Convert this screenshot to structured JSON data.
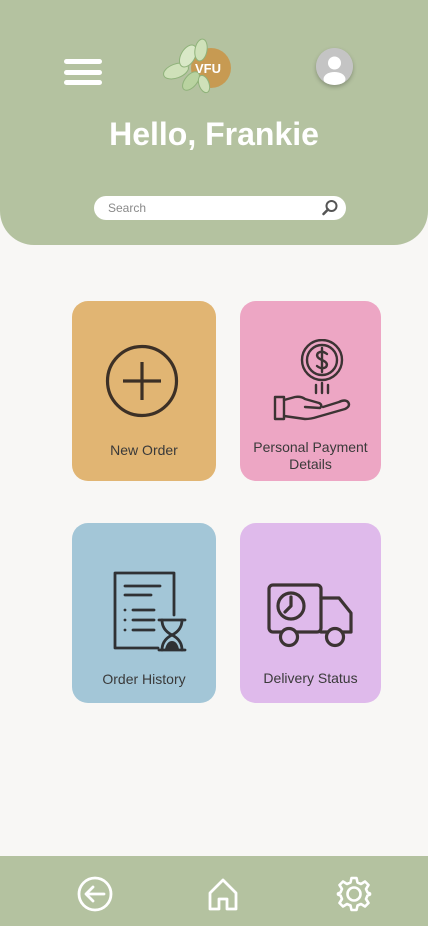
{
  "header": {
    "logo_text": "VFU",
    "greeting": "Hello, Frankie"
  },
  "search": {
    "placeholder": "Search"
  },
  "tiles": [
    {
      "label": "New Order",
      "icon": "plus-circle-icon",
      "color": "#e1b573"
    },
    {
      "label_line1": "Personal Payment",
      "label_line2": "Details",
      "icon": "hand-coin-icon",
      "color": "#eda6c4"
    },
    {
      "label": "Order History",
      "icon": "document-hourglass-icon",
      "color": "#a3c6d7"
    },
    {
      "label": "Delivery Status",
      "icon": "delivery-truck-icon",
      "color": "#dfbaeb"
    }
  ],
  "nav": {
    "items": [
      "back-icon",
      "home-icon",
      "settings-icon"
    ]
  },
  "colors": {
    "header": "#b4c2a0",
    "background": "#f8f7f5",
    "icon_stroke": "#3c3333"
  }
}
